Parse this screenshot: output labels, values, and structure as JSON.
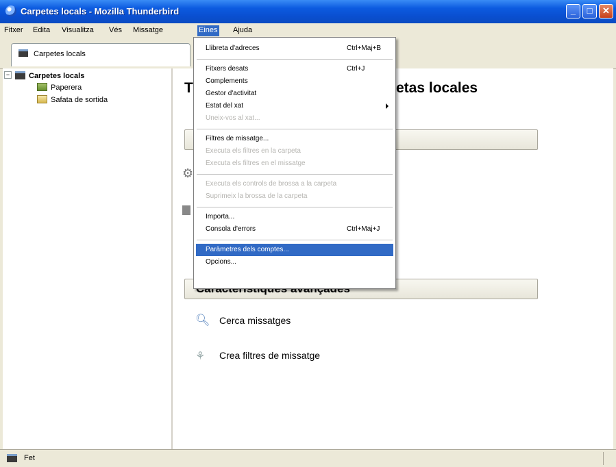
{
  "window": {
    "title": "Carpetes locals - Mozilla Thunderbird"
  },
  "menubar": {
    "items": [
      "Fitxer",
      "Edita",
      "Visualitza",
      "Vés",
      "Missatge",
      "Eines",
      "Ajuda"
    ]
  },
  "tab": {
    "label": "Carpetes locals"
  },
  "folders": {
    "root": "Carpetes locals",
    "children": [
      "Paperera",
      "Safata de sortida"
    ]
  },
  "content": {
    "title_partial": "T",
    "title_suffix": "etas locales",
    "advanced_section": "Característiques avançades",
    "features": [
      "Cerca missatges",
      "Crea filtres de missatge"
    ]
  },
  "tools_menu": {
    "items": [
      {
        "label": "Llibreta d'adreces",
        "shortcut": "Ctrl+Maj+B"
      },
      {
        "label": "Fitxers desats",
        "shortcut": "Ctrl+J"
      },
      {
        "label": "Complements",
        "shortcut": ""
      },
      {
        "label": "Gestor d'activitat",
        "shortcut": ""
      },
      {
        "label": "Estat del xat",
        "shortcut": ""
      },
      {
        "label": "Uneix-vos al xat...",
        "shortcut": ""
      },
      {
        "label": "Filtres de missatge...",
        "shortcut": ""
      },
      {
        "label": "Executa els filtres en la carpeta",
        "shortcut": ""
      },
      {
        "label": "Executa els filtres en el missatge",
        "shortcut": ""
      },
      {
        "label": "Executa els controls de brossa a la carpeta",
        "shortcut": ""
      },
      {
        "label": "Suprimeix la brossa de la carpeta",
        "shortcut": ""
      },
      {
        "label": "Importa...",
        "shortcut": ""
      },
      {
        "label": "Consola d'errors",
        "shortcut": "Ctrl+Maj+J"
      },
      {
        "label": "Paràmetres dels comptes...",
        "shortcut": ""
      },
      {
        "label": "Opcions...",
        "shortcut": ""
      }
    ]
  },
  "status": {
    "text": "Fet"
  }
}
